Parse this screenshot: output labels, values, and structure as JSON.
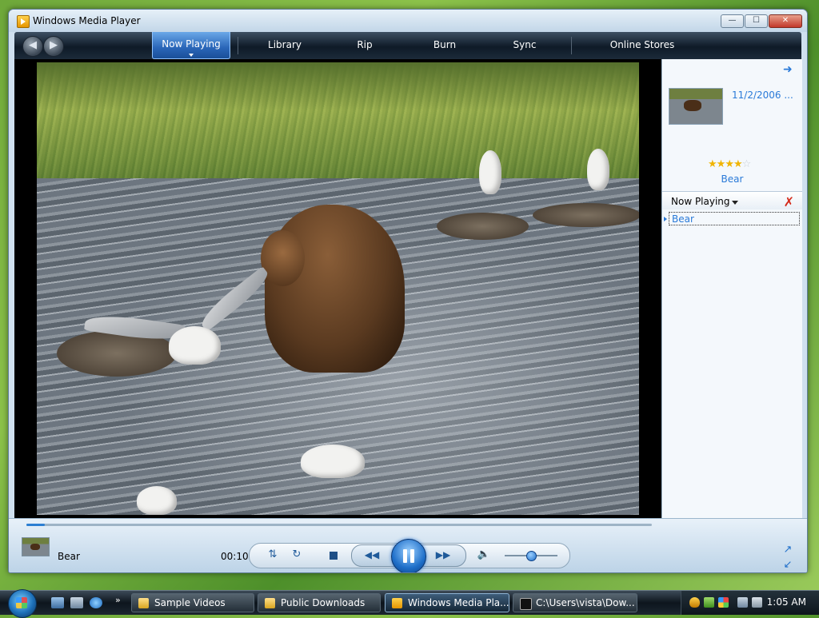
{
  "window": {
    "title": "Windows Media Player"
  },
  "nav": {
    "tabs": [
      {
        "label": "Now Playing"
      },
      {
        "label": "Library"
      },
      {
        "label": "Rip"
      },
      {
        "label": "Burn"
      },
      {
        "label": "Sync"
      },
      {
        "label": "Online Stores"
      }
    ]
  },
  "info_pane": {
    "date": "11/2/2006 ...",
    "rating": 4,
    "rating_max": 5,
    "title": "Bear"
  },
  "list_pane": {
    "header": "Now Playing",
    "items": [
      {
        "label": "Bear"
      }
    ]
  },
  "controls": {
    "track_name": "Bear",
    "time": "00:10",
    "progress": 0.03,
    "volume": 0.5
  },
  "taskbar": {
    "items": [
      {
        "label": "Sample Videos"
      },
      {
        "label": "Public Downloads"
      },
      {
        "label": "Windows Media Pla..."
      },
      {
        "label": "C:\\Users\\vista\\Dow..."
      }
    ],
    "clock": "1:05 AM"
  },
  "colors": {
    "accent": "#2a7ad8",
    "active_tab": "#2a66b8"
  },
  "icons": {
    "back": "back-arrow-icon",
    "forward": "forward-arrow-icon",
    "shuffle": "shuffle-icon",
    "repeat": "repeat-icon",
    "stop": "stop-icon",
    "previous": "previous-icon",
    "pause": "pause-icon",
    "next": "next-icon",
    "mute": "speaker-icon"
  }
}
